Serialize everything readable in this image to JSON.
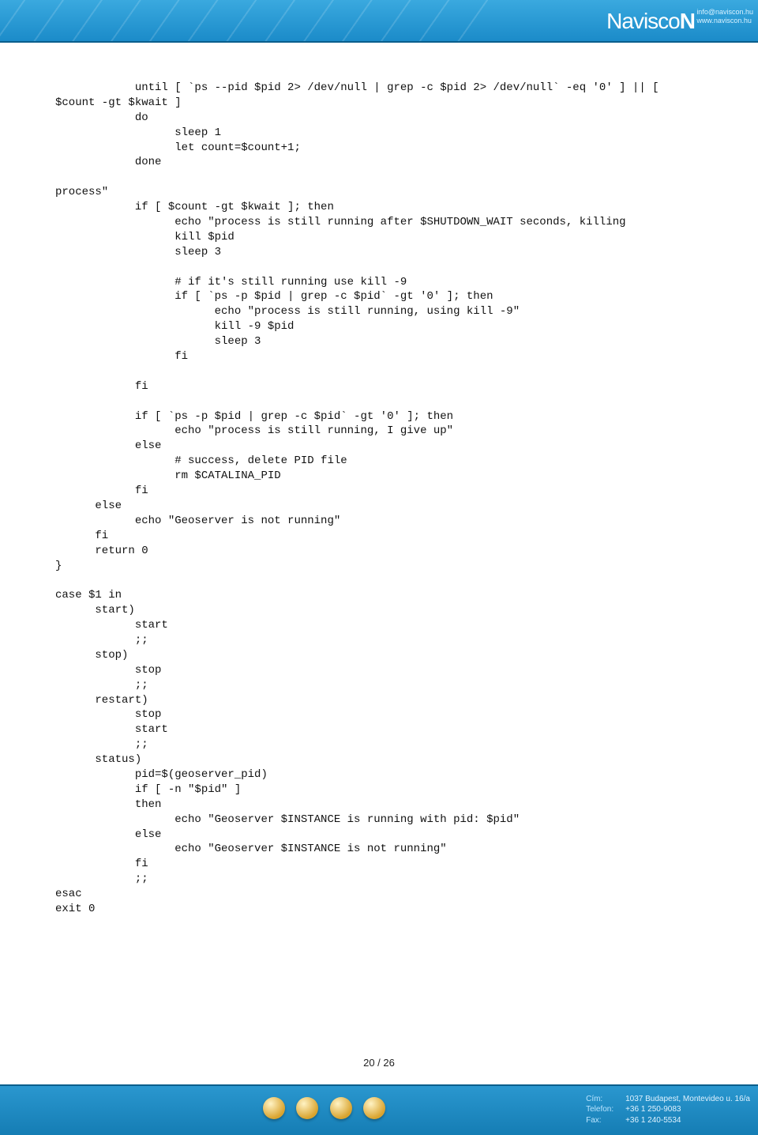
{
  "header": {
    "brand": "NaviscoN",
    "brand_plain": "Navisco",
    "brand_accent": "N",
    "contact_email": "info@naviscon.hu",
    "contact_web": "www.naviscon.hu"
  },
  "code": "            until [ `ps --pid $pid 2> /dev/null | grep -c $pid 2> /dev/null` -eq '0' ] || [\n$count -gt $kwait ]\n            do\n                  sleep 1\n                  let count=$count+1;\n            done\n\nprocess\"\n            if [ $count -gt $kwait ]; then\n                  echo \"process is still running after $SHUTDOWN_WAIT seconds, killing\n                  kill $pid\n                  sleep 3\n\n                  # if it's still running use kill -9\n                  if [ `ps -p $pid | grep -c $pid` -gt '0' ]; then\n                        echo \"process is still running, using kill -9\"\n                        kill -9 $pid\n                        sleep 3\n                  fi\n\n            fi\n\n            if [ `ps -p $pid | grep -c $pid` -gt '0' ]; then\n                  echo \"process is still running, I give up\"\n            else\n                  # success, delete PID file\n                  rm $CATALINA_PID\n            fi\n      else\n            echo \"Geoserver is not running\"\n      fi\n      return 0\n}\n\ncase $1 in\n      start)\n            start\n            ;;\n      stop)\n            stop\n            ;;\n      restart)\n            stop\n            start\n            ;;\n      status)\n            pid=$(geoserver_pid)\n            if [ -n \"$pid\" ]\n            then\n                  echo \"Geoserver $INSTANCE is running with pid: $pid\"\n            else\n                  echo \"Geoserver $INSTANCE is not running\"\n            fi\n            ;;\nesac\nexit 0",
  "page_number": "20 / 26",
  "footer": {
    "addr_label": "Cím:",
    "addr_value": "1037 Budapest, Montevideo u. 16/a",
    "tel_label": "Telefon:",
    "tel_value": "+36 1 250-9083",
    "fax_label": "Fax:",
    "fax_value": "+36 1 240-5534"
  }
}
